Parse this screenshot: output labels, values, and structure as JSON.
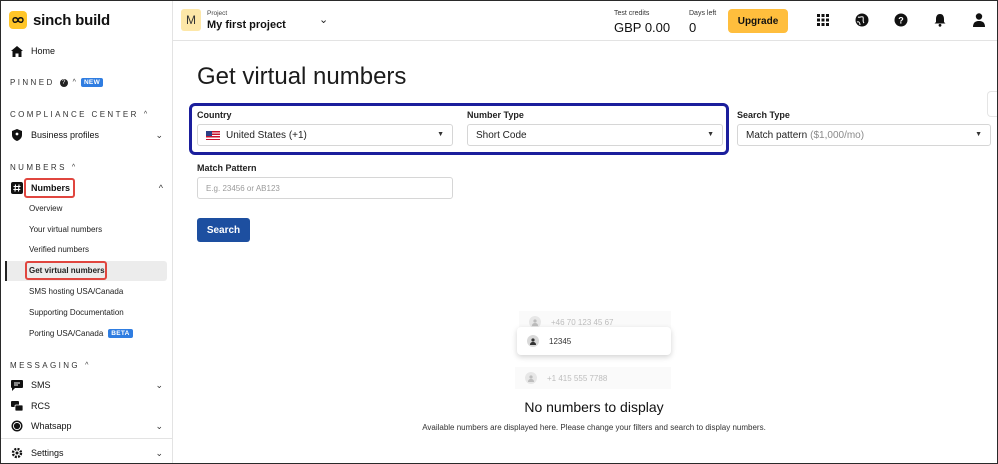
{
  "app": {
    "brand": "sinch build"
  },
  "sidebar": {
    "home": "Home",
    "pinned": {
      "label": "PINNED",
      "badge": "NEW"
    },
    "compliance": {
      "label": "COMPLIANCE CENTER",
      "business_profiles": "Business profiles"
    },
    "numbers_section": "NUMBERS",
    "numbers": {
      "label": "Numbers",
      "items": [
        {
          "label": "Overview"
        },
        {
          "label": "Your virtual numbers"
        },
        {
          "label": "Verified numbers"
        },
        {
          "label": "Get virtual numbers"
        },
        {
          "label": "SMS hosting USA/Canada"
        },
        {
          "label": "Supporting Documentation"
        },
        {
          "label": "Porting USA/Canada",
          "badge": "BETA"
        }
      ]
    },
    "messaging_section": "MESSAGING",
    "messaging": [
      {
        "label": "SMS"
      },
      {
        "label": "RCS"
      },
      {
        "label": "Whatsapp"
      }
    ],
    "settings": "Settings"
  },
  "topbar": {
    "project_avatar": "M",
    "project_caption": "Project",
    "project_name": "My first project",
    "test_credits_label": "Test credits",
    "test_credits_value": "GBP 0.00",
    "days_left_label": "Days left",
    "days_left_value": "0",
    "upgrade_label": "Upgrade"
  },
  "main": {
    "title": "Get virtual numbers",
    "country": {
      "label": "Country",
      "value": "United States (+1)"
    },
    "number_type": {
      "label": "Number Type",
      "value": "Short Code"
    },
    "search_type": {
      "label": "Search Type",
      "value": "Match pattern",
      "price": "($1,000/mo)"
    },
    "match_pattern": {
      "label": "Match Pattern",
      "placeholder": "E.g. 23456 or AB123"
    },
    "search_button": "Search",
    "illustration": [
      "+46 70 123 45 67",
      "12345",
      "+1 415 555 7788"
    ],
    "empty_title": "No numbers to display",
    "empty_subtitle": "Available numbers are displayed here. Please change your filters and search to display numbers."
  },
  "colors": {
    "brand_yellow": "#ffc629",
    "upgrade": "#ffbe3d",
    "primary_button": "#1d4fa0",
    "badge_blue": "#2f7de1",
    "highlight_red": "#e0463f",
    "highlight_blue": "#1b1e9c"
  }
}
